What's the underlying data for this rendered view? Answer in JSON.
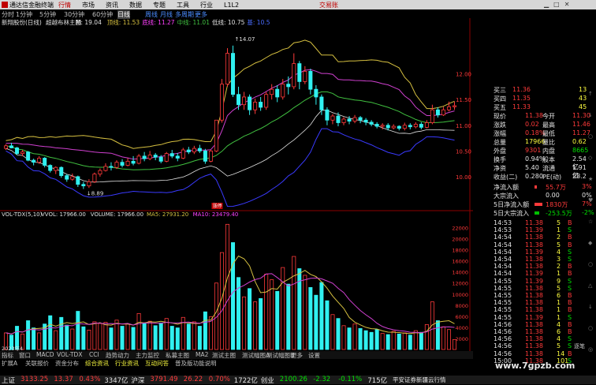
{
  "window": {
    "title": "通达信金融终端",
    "menus": [
      "行情",
      "市场",
      "资讯",
      "数据",
      "专题",
      "工具",
      "行业",
      "L1L2"
    ],
    "active_menu": "行情",
    "account": "交易账"
  },
  "periods": [
    "分时",
    "1分钟",
    "5分钟",
    "30分钟",
    "60分钟",
    "日线",
    "周线",
    "月线",
    "多周期",
    "更多"
  ],
  "selected_period": "日线",
  "main_chart": {
    "header_name": "新翔股份(日线)",
    "indicator": "超越布林主图",
    "values": [
      "M: 19.04",
      "顶线: 11.53",
      "底线: 11.27",
      "中线: 11.01",
      "低线: 10.75",
      "基: 10.5"
    ],
    "annotation_high": "14.07",
    "annotation_low": "8.89",
    "annotation_mark": "涨停",
    "y_ticks": [
      "12.00",
      "11.50",
      "11.00",
      "10.50",
      "10.00"
    ]
  },
  "vol_chart": {
    "header": "VOL-TDX(5,10)",
    "values": [
      "VVOL: 17966.00",
      "VOLUME: 17966.00",
      "MA5: 27931.20",
      "MA10: 23479.40"
    ],
    "y_ticks": [
      "22000",
      "20000",
      "18000",
      "16000",
      "14000",
      "12000",
      "10000",
      "8000",
      "6000",
      "4000",
      "2000"
    ],
    "date_label": "2023年4"
  },
  "quote": {
    "asks": [
      {
        "label": "买四",
        "price": "11.35",
        "vol": "43"
      },
      {
        "label": "买五",
        "price": "11.33",
        "vol": "45"
      }
    ],
    "ask_top": {
      "label": "买三",
      "price": "11.36",
      "vol": "13"
    },
    "fields": [
      {
        "l": "现价",
        "v": "11.38",
        "l2": "今开",
        "v2": "11.30"
      },
      {
        "l": "涨跌",
        "v": "0.02",
        "l2": "最高",
        "v2": "11.46"
      },
      {
        "l": "涨幅",
        "v": "0.18%",
        "l2": "最低",
        "v2": "11.27"
      },
      {
        "l": "总量",
        "v": "17966",
        "l2": "量比",
        "v2": "0.62"
      },
      {
        "l": "外盘",
        "v": "9301",
        "l2": "内盘",
        "v2": "8665"
      },
      {
        "l": "换手",
        "v": "0.94%",
        "l2": "股本",
        "v2": "2.54亿"
      },
      {
        "l": "净资",
        "v": "5.40",
        "l2": "流通",
        "v2": "1.91亿"
      },
      {
        "l": "收益(二)",
        "v": "0.280",
        "l2": "PE(动)",
        "v2": "28.2"
      }
    ],
    "flows": [
      {
        "l": "净流入额",
        "v": "55.7万",
        "p": "3%"
      },
      {
        "l": "大宗流入",
        "v": "0.00",
        "p": "0%"
      },
      {
        "l": "5日净流入额",
        "v": "1830万",
        "p": "7%"
      },
      {
        "l": "5日大宗流入",
        "v": "-253.5万",
        "p": "-2%"
      }
    ]
  },
  "ticks": [
    {
      "t": "14:53",
      "p": "11.38",
      "v": "5",
      "d": "B"
    },
    {
      "t": "14:53",
      "p": "11.39",
      "v": "1",
      "d": "S"
    },
    {
      "t": "14:54",
      "p": "11.38",
      "v": "2",
      "d": "B"
    },
    {
      "t": "14:54",
      "p": "11.38",
      "v": "5",
      "d": "B"
    },
    {
      "t": "14:54",
      "p": "11.39",
      "v": "4",
      "d": "S"
    },
    {
      "t": "14:54",
      "p": "11.38",
      "v": "3",
      "d": "S"
    },
    {
      "t": "14:54",
      "p": "11.38",
      "v": "2",
      "d": "B"
    },
    {
      "t": "14:54",
      "p": "11.39",
      "v": "1",
      "d": "B"
    },
    {
      "t": "14:55",
      "p": "11.39",
      "v": "9",
      "d": "S"
    },
    {
      "t": "14:55",
      "p": "11.38",
      "v": "5",
      "d": "S"
    },
    {
      "t": "14:55",
      "p": "11.38",
      "v": "6",
      "d": "B"
    },
    {
      "t": "14:55",
      "p": "11.38",
      "v": "1",
      "d": "B"
    },
    {
      "t": "14:55",
      "p": "11.38",
      "v": "1",
      "d": "B"
    },
    {
      "t": "14:55",
      "p": "11.39",
      "v": "1",
      "d": "S"
    },
    {
      "t": "14:56",
      "p": "11.38",
      "v": "4",
      "d": "B"
    },
    {
      "t": "14:56",
      "p": "11.38",
      "v": "6",
      "d": "B"
    },
    {
      "t": "14:56",
      "p": "11.38",
      "v": "4",
      "d": "S"
    },
    {
      "t": "14:56",
      "p": "11.38",
      "v": "5",
      "d": "S"
    },
    {
      "t": "14:56",
      "p": "11.38",
      "v": "14",
      "d": "B"
    },
    {
      "t": "15:00",
      "p": "11.38",
      "v": "101",
      "d": "S"
    }
  ],
  "indicator_tabs": [
    "指标",
    "窗口",
    "MACD",
    "VOL-TDX",
    "CCI",
    "趋势动力",
    "主力监控",
    "私募主图",
    "MA2",
    "测试主图",
    "测试幅图A",
    "测试幅图B",
    "更多",
    "设置"
  ],
  "sub_tabs": [
    "扩展A",
    "关联报价",
    "资金分布",
    "综合资讯",
    "行业资讯",
    "互动问答",
    "普及版功能说明"
  ],
  "panel_tab": "逐笔",
  "index_bar": [
    {
      "name": "上证",
      "val": "3133.25",
      "chg": "13.37",
      "pct": "0.43%",
      "amt": "3347亿",
      "color": "red"
    },
    {
      "name": "沪深",
      "val": "3791.49",
      "chg": "26.22",
      "pct": "0.70%",
      "amt": "1722亿",
      "color": "red"
    },
    {
      "name": "创业",
      "val": "2100.26",
      "chg": "-2.32",
      "pct": "-0.11%",
      "amt": "715亿",
      "color": "grn"
    }
  ],
  "status_right": "平安证券新疆云行情",
  "watermark": "www.7gpzb.com",
  "colors": {
    "up": "#ff3a3a",
    "down": "#30f0f0",
    "boll_upper": "#d6c040",
    "boll_mid": "#d040d0",
    "boll_lower": "#3a3aff",
    "ma": "#40c040"
  },
  "candles": [
    [
      10.55,
      10.6,
      10.52,
      10.63
    ],
    [
      10.6,
      10.56,
      10.55,
      10.66
    ],
    [
      10.56,
      10.45,
      10.42,
      10.58
    ],
    [
      10.45,
      10.48,
      10.4,
      10.52
    ],
    [
      10.48,
      10.32,
      10.3,
      10.5
    ],
    [
      10.32,
      10.28,
      10.22,
      10.35
    ],
    [
      10.28,
      10.36,
      10.25,
      10.4
    ],
    [
      10.36,
      10.22,
      10.18,
      10.38
    ],
    [
      10.22,
      10.12,
      10.08,
      10.24
    ],
    [
      10.12,
      10.18,
      10.05,
      10.2
    ],
    [
      10.18,
      10.02,
      9.98,
      10.2
    ],
    [
      10.02,
      9.95,
      9.9,
      10.05
    ],
    [
      9.95,
      10.0,
      9.92,
      10.06
    ],
    [
      10.0,
      9.85,
      9.8,
      10.02
    ],
    [
      9.85,
      9.82,
      9.76,
      9.9
    ],
    [
      9.82,
      9.9,
      9.78,
      9.95
    ],
    [
      9.9,
      10.05,
      9.88,
      10.08
    ],
    [
      10.05,
      10.12,
      10.0,
      10.16
    ],
    [
      10.12,
      10.2,
      10.1,
      10.26
    ],
    [
      10.2,
      10.18,
      10.12,
      10.28
    ],
    [
      10.18,
      10.28,
      10.15,
      10.32
    ],
    [
      10.28,
      10.22,
      10.18,
      10.34
    ],
    [
      10.22,
      10.3,
      10.2,
      10.36
    ],
    [
      10.3,
      10.26,
      10.22,
      10.4
    ],
    [
      10.26,
      10.4,
      10.24,
      10.44
    ],
    [
      10.4,
      10.35,
      10.3,
      10.48
    ],
    [
      10.35,
      10.42,
      10.32,
      10.5
    ],
    [
      10.42,
      10.38,
      10.32,
      10.46
    ],
    [
      10.38,
      10.3,
      10.26,
      10.42
    ],
    [
      10.3,
      10.45,
      10.28,
      10.48
    ],
    [
      10.45,
      10.4,
      10.36,
      10.52
    ],
    [
      10.4,
      10.36,
      10.3,
      10.46
    ],
    [
      10.36,
      10.52,
      10.34,
      10.56
    ],
    [
      10.52,
      10.48,
      10.44,
      10.58
    ],
    [
      10.48,
      10.55,
      10.44,
      10.6
    ],
    [
      10.55,
      10.5,
      10.46,
      10.62
    ],
    [
      10.5,
      10.3,
      10.25,
      10.54
    ],
    [
      10.3,
      10.5,
      10.28,
      10.52
    ],
    [
      10.5,
      11.1,
      10.48,
      11.1
    ],
    [
      11.1,
      11.8,
      11.05,
      11.9
    ],
    [
      11.8,
      12.4,
      11.75,
      12.5
    ],
    [
      12.4,
      11.6,
      11.55,
      12.55
    ],
    [
      11.6,
      11.4,
      11.3,
      11.75
    ],
    [
      11.4,
      11.55,
      11.3,
      11.65
    ],
    [
      11.55,
      11.3,
      11.2,
      11.6
    ],
    [
      11.3,
      11.45,
      11.22,
      11.52
    ],
    [
      11.45,
      11.35,
      11.28,
      11.55
    ],
    [
      11.35,
      11.6,
      11.3,
      11.65
    ],
    [
      11.6,
      11.7,
      11.5,
      11.8
    ],
    [
      11.7,
      11.55,
      11.45,
      11.78
    ],
    [
      11.55,
      11.8,
      11.5,
      11.9
    ],
    [
      11.8,
      11.75,
      11.6,
      11.95
    ],
    [
      11.75,
      12.2,
      11.7,
      12.4
    ],
    [
      12.2,
      11.85,
      11.7,
      12.25
    ],
    [
      11.85,
      12.05,
      11.8,
      12.15
    ],
    [
      12.05,
      11.7,
      11.6,
      12.1
    ],
    [
      11.7,
      11.55,
      11.4,
      11.78
    ],
    [
      11.55,
      11.3,
      11.2,
      11.6
    ],
    [
      11.3,
      11.1,
      11.0,
      11.35
    ],
    [
      11.1,
      11.18,
      11.02,
      11.22
    ],
    [
      11.18,
      11.05,
      10.98,
      11.25
    ],
    [
      11.05,
      11.12,
      11.0,
      11.16
    ],
    [
      11.12,
      11.08,
      11.02,
      11.18
    ],
    [
      11.08,
      11.15,
      11.04,
      11.2
    ],
    [
      11.15,
      11.1,
      11.04,
      11.18
    ],
    [
      11.1,
      11.06,
      11.0,
      11.14
    ],
    [
      11.06,
      11.02,
      10.98,
      11.1
    ],
    [
      11.02,
      10.98,
      10.94,
      11.06
    ],
    [
      10.98,
      11.0,
      10.92,
      11.04
    ],
    [
      11.0,
      10.95,
      10.9,
      11.04
    ],
    [
      10.95,
      10.98,
      10.92,
      11.02
    ],
    [
      10.98,
      10.94,
      10.9,
      11.0
    ],
    [
      10.94,
      11.0,
      10.9,
      11.05
    ],
    [
      11.0,
      10.97,
      10.92,
      11.04
    ],
    [
      10.97,
      11.02,
      10.94,
      11.06
    ],
    [
      11.02,
      10.96,
      10.92,
      11.06
    ],
    [
      10.96,
      11.05,
      10.94,
      11.1
    ],
    [
      11.05,
      11.3,
      11.02,
      11.4
    ],
    [
      11.3,
      11.2,
      11.15,
      11.35
    ],
    [
      11.2,
      11.3,
      11.18,
      11.36
    ],
    [
      11.3,
      11.36,
      11.27,
      11.46
    ],
    [
      11.36,
      11.38,
      11.3,
      11.46
    ]
  ],
  "volumes": [
    3000,
    2600,
    4200,
    2800,
    5200,
    3900,
    3000,
    4600,
    6100,
    3400,
    5800,
    4400,
    3700,
    6900,
    4100,
    3500,
    5000,
    4700,
    4900,
    3900,
    5300,
    4200,
    4600,
    4000,
    6500,
    4800,
    5100,
    4300,
    4800,
    5600,
    4200,
    3900,
    5800,
    4600,
    5000,
    4200,
    6800,
    5900,
    12000,
    17500,
    22600,
    19300,
    13000,
    9500,
    11000,
    8600,
    9200,
    13600,
    12600,
    10500,
    14800,
    11800,
    16800,
    14600,
    13400,
    11200,
    9800,
    12100,
    8800,
    6300,
    5600,
    4300,
    3900,
    4600,
    3800,
    3400,
    3100,
    3600,
    2900,
    2700,
    3300,
    2800,
    3000,
    2600,
    3400,
    3100,
    4500,
    8600,
    5200,
    4100,
    3600,
    1800
  ]
}
